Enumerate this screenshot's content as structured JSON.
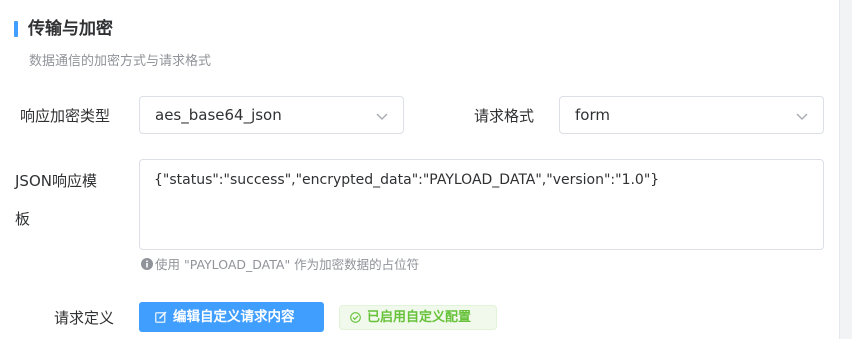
{
  "section": {
    "title": "传输与加密",
    "description": "数据通信的加密方式与请求格式",
    "accent_color": "#409eff"
  },
  "response_encryption_type": {
    "label": "响应加密类型",
    "value": "aes_base64_json"
  },
  "request_format": {
    "label": "请求格式",
    "value": "form"
  },
  "json_response_template": {
    "label_line1": "JSON响应模",
    "label_line2": "板",
    "value": "{\"status\":\"success\",\"encrypted_data\":\"PAYLOAD_DATA\",\"version\":\"1.0\"}",
    "hint": "使用 \"PAYLOAD_DATA\" 作为加密数据的占位符",
    "hint_icon": "info-icon"
  },
  "request_definition": {
    "label": "请求定义",
    "edit_button_label": "编辑自定义请求内容",
    "edit_button_icon": "edit-icon",
    "status_tag": "已启用自定义配置",
    "status_icon": "check-circle-icon",
    "status_color": "#67c23a"
  }
}
